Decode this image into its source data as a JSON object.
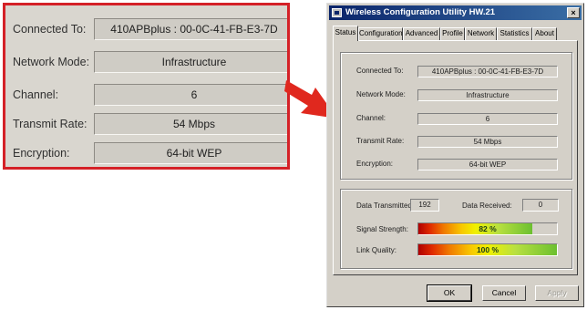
{
  "callout": {
    "rows": [
      {
        "label": "Connected To:",
        "value": "410APBplus : 00-0C-41-FB-E3-7D"
      },
      {
        "label": "Network Mode:",
        "value": "Infrastructure"
      },
      {
        "label": "Channel:",
        "value": "6"
      },
      {
        "label": "Transmit Rate:",
        "value": "54 Mbps"
      },
      {
        "label": "Encryption:",
        "value": "64-bit WEP"
      }
    ]
  },
  "window": {
    "title": "Wireless Configuration Utility HW.21",
    "close_glyph": "×"
  },
  "tabs": [
    "Status",
    "Configuration",
    "Advanced",
    "Profile",
    "Network",
    "Statistics",
    "About"
  ],
  "status": {
    "rows": [
      {
        "label": "Connected To:",
        "value": "410APBplus : 00-0C-41-FB-E3-7D"
      },
      {
        "label": "Network Mode:",
        "value": "Infrastructure"
      },
      {
        "label": "Channel:",
        "value": "6"
      },
      {
        "label": "Transmit Rate:",
        "value": "54 Mbps"
      },
      {
        "label": "Encryption:",
        "value": "64-bit WEP"
      }
    ],
    "data_transmitted_label": "Data Transmitted:",
    "data_transmitted": "192",
    "data_received_label": "Data Received:",
    "data_received": "0",
    "signal_strength_label": "Signal Strength:",
    "signal_strength_text": "82 %",
    "signal_strength_fraction": 0.82,
    "link_quality_label": "Link Quality:",
    "link_quality_text": "100 %",
    "link_quality_fraction": 1.0
  },
  "buttons": {
    "ok": "OK",
    "cancel": "Cancel",
    "apply": "Apply"
  },
  "colors": {
    "callout_border": "#d42127",
    "arrow": "#e0281e",
    "title_start": "#0a246a"
  }
}
